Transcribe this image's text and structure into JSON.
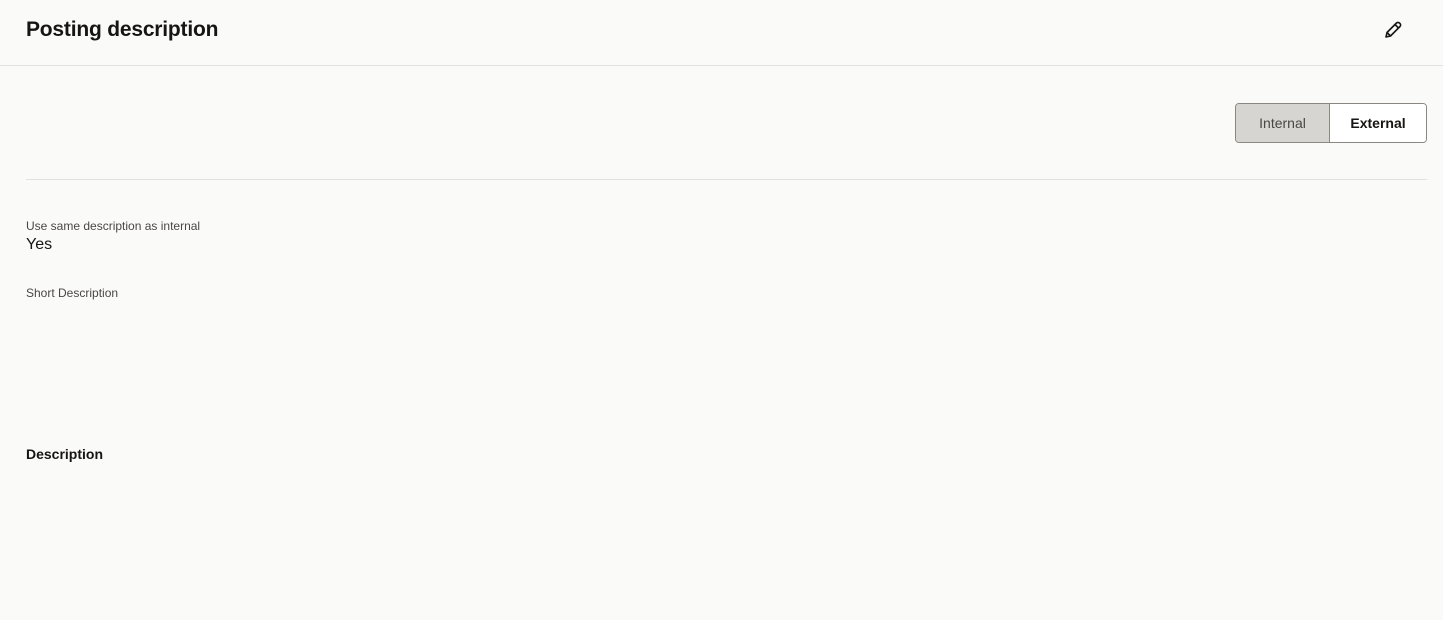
{
  "header": {
    "title": "Posting description",
    "edit_icon": "pencil-icon"
  },
  "toggle": {
    "options": [
      "Internal",
      "External"
    ],
    "selected": "Internal"
  },
  "fields": {
    "same_description": {
      "label": "Use same description as internal",
      "value": "Yes"
    },
    "short_description": {
      "label": "Short Description",
      "value": ""
    },
    "description": {
      "label": "Description",
      "value": ""
    }
  }
}
